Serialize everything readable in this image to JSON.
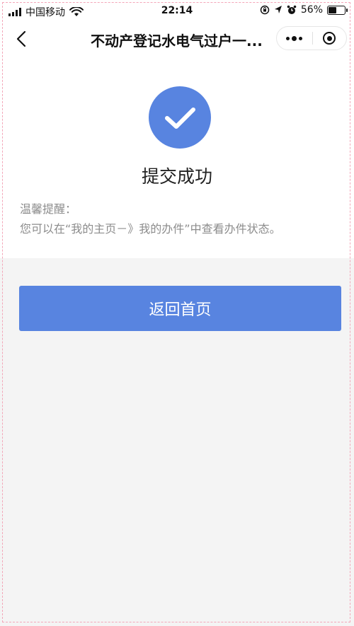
{
  "status_bar": {
    "carrier": "中国移动",
    "time": "22:14",
    "battery": "56%",
    "battery_level": 0.56
  },
  "nav": {
    "title": "不动产登记水电气过户一...",
    "icons": [
      "back-icon",
      "more-icon",
      "close-icon"
    ]
  },
  "result": {
    "title": "提交成功",
    "tips_label": "温馨提醒：",
    "tips_text": "您可以在“我的主页－》我的办件”中查看办件状态。",
    "icon": "checkmark-icon"
  },
  "actions": {
    "home_label": "返回首页"
  },
  "colors": {
    "accent": "#5884e0",
    "card_bg": "#ffffff",
    "page_bg": "#f4f4f4",
    "muted_text": "#8c8c8c"
  }
}
